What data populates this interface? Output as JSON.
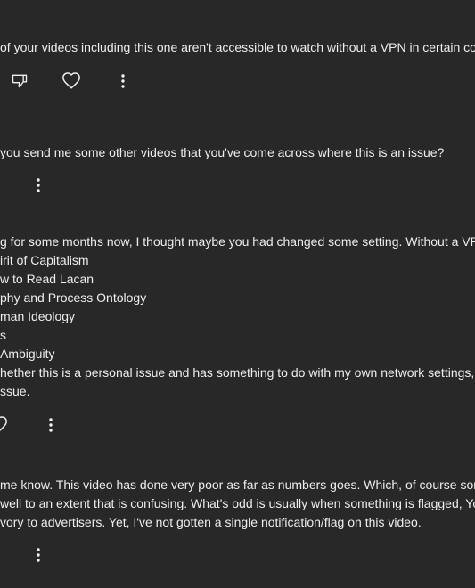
{
  "comments": [
    {
      "lines": [
        " of your videos including this one aren't accessible to watch without a VPN in certain cou"
      ]
    },
    {
      "lines": [
        " you send me some other videos that you've come across where this is an issue?"
      ]
    },
    {
      "lines": [
        "g for some months now, I thought maybe you had changed some setting. Without a VPN",
        "irit of Capitalism",
        "w to Read Lacan",
        "phy and Process Ontology",
        "man Ideology",
        "s",
        "Ambiguity",
        "hether this is a personal issue and has something to do with my own network settings, bu",
        "ssue."
      ]
    },
    {
      "lines": [
        "me know. This video has done very poor as far as numbers goes. Which, of course some",
        "well to an extent that is confusing. What's odd is usually when something is flagged, You",
        "vory to advertisers. Yet, I've not gotten a single notification/flag on this video."
      ]
    }
  ],
  "icons": {
    "dislike": "thumbs-down-icon",
    "heart": "heart-icon",
    "more": "more-vertical-icon"
  },
  "colors": {
    "background": "#282828",
    "text": "#eeeeee",
    "icon": "#f1f1f1"
  }
}
